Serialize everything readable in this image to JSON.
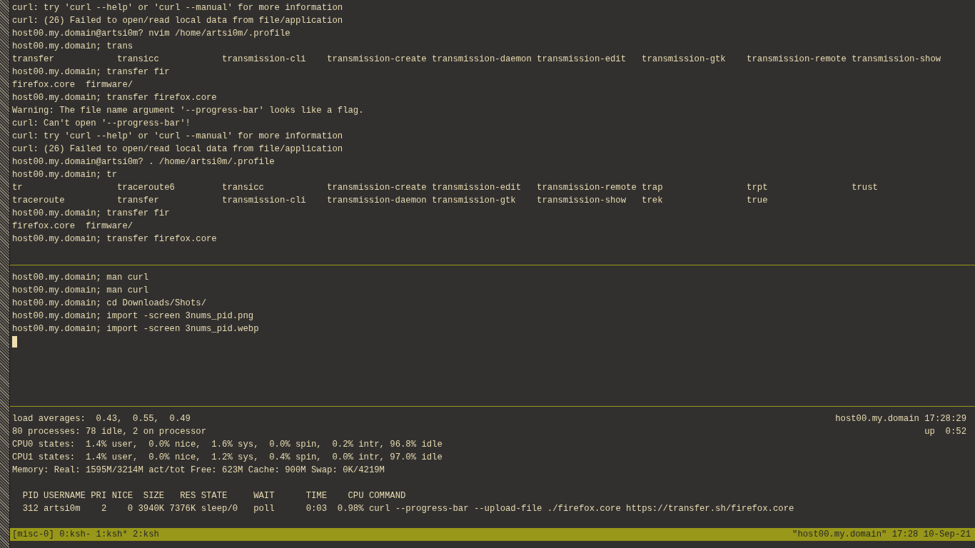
{
  "panes": [
    {
      "rows": [
        {
          "kind": "line",
          "text": "curl: try 'curl --help' or 'curl --manual' for more information"
        },
        {
          "kind": "line",
          "text": "curl: (26) Failed to open/read local data from file/application"
        },
        {
          "kind": "line",
          "text": "host00.my.domain@artsi0m? nvim /home/artsi0m/.profile"
        },
        {
          "kind": "line",
          "text": "host00.my.domain; trans"
        },
        {
          "kind": "completions",
          "items": [
            "transfer",
            "transicc",
            "transmission-cli",
            "transmission-create",
            "transmission-daemon",
            "transmission-edit",
            "transmission-gtk",
            "transmission-remote",
            "transmission-show"
          ]
        },
        {
          "kind": "line",
          "text": "host00.my.domain; transfer fir"
        },
        {
          "kind": "line",
          "text": "firefox.core  firmware/"
        },
        {
          "kind": "line",
          "text": "host00.my.domain; transfer firefox.core"
        },
        {
          "kind": "line",
          "text": "Warning: The file name argument '--progress-bar' looks like a flag."
        },
        {
          "kind": "line",
          "text": "curl: Can't open '--progress-bar'!"
        },
        {
          "kind": "line",
          "text": "curl: try 'curl --help' or 'curl --manual' for more information"
        },
        {
          "kind": "line",
          "text": "curl: (26) Failed to open/read local data from file/application"
        },
        {
          "kind": "line",
          "text": "host00.my.domain@artsi0m? . /home/artsi0m/.profile"
        },
        {
          "kind": "line",
          "text": "host00.my.domain; tr"
        },
        {
          "kind": "completions",
          "items": [
            "tr",
            "traceroute6",
            "transicc",
            "transmission-create",
            "transmission-edit",
            "transmission-remote",
            "trap",
            "trpt",
            "trust"
          ]
        },
        {
          "kind": "completions",
          "items": [
            "traceroute",
            "transfer",
            "transmission-cli",
            "transmission-daemon",
            "transmission-gtk",
            "transmission-show",
            "trek",
            "true"
          ]
        },
        {
          "kind": "line",
          "text": "host00.my.domain; transfer fir"
        },
        {
          "kind": "line",
          "text": "firefox.core  firmware/"
        },
        {
          "kind": "line",
          "text": "host00.my.domain; transfer firefox.core"
        }
      ]
    },
    {
      "rows": [
        {
          "kind": "line",
          "text": "host00.my.domain; man curl"
        },
        {
          "kind": "line",
          "text": "host00.my.domain; man curl"
        },
        {
          "kind": "line",
          "text": "host00.my.domain; cd Downloads/Shots/"
        },
        {
          "kind": "line",
          "text": "host00.my.domain; import -screen 3nums_pid.png"
        },
        {
          "kind": "line",
          "text": "host00.my.domain; import -screen 3nums_pid.webp"
        },
        {
          "kind": "cursor"
        }
      ]
    },
    {
      "rows": [
        {
          "kind": "split",
          "text": "load averages:  0.43,  0.55,  0.49",
          "right": "host00.my.domain 17:28:29"
        },
        {
          "kind": "split",
          "text": "80 processes: 78 idle, 2 on processor",
          "right": "up  0:52"
        },
        {
          "kind": "line",
          "text": "CPU0 states:  1.4% user,  0.0% nice,  1.6% sys,  0.0% spin,  0.2% intr, 96.8% idle"
        },
        {
          "kind": "line",
          "text": "CPU1 states:  1.4% user,  0.0% nice,  1.2% sys,  0.4% spin,  0.0% intr, 97.0% idle"
        },
        {
          "kind": "line",
          "text": "Memory: Real: 1595M/3214M act/tot Free: 623M Cache: 900M Swap: 0K/4219M"
        },
        {
          "kind": "blank"
        },
        {
          "kind": "line",
          "text": "  PID USERNAME PRI NICE  SIZE   RES STATE     WAIT      TIME    CPU COMMAND"
        },
        {
          "kind": "line",
          "text": "  312 artsi0m    2    0 3940K 7376K sleep/0   poll      0:03  0.98% curl --progress-bar --upload-file ./firefox.core https://transfer.sh/firefox.core"
        }
      ]
    }
  ],
  "status_bar": {
    "left": "[misc-0] 0:ksh- 1:ksh* 2:ksh",
    "right": "\"host00.my.domain\" 17:28 10-Sep-21"
  }
}
